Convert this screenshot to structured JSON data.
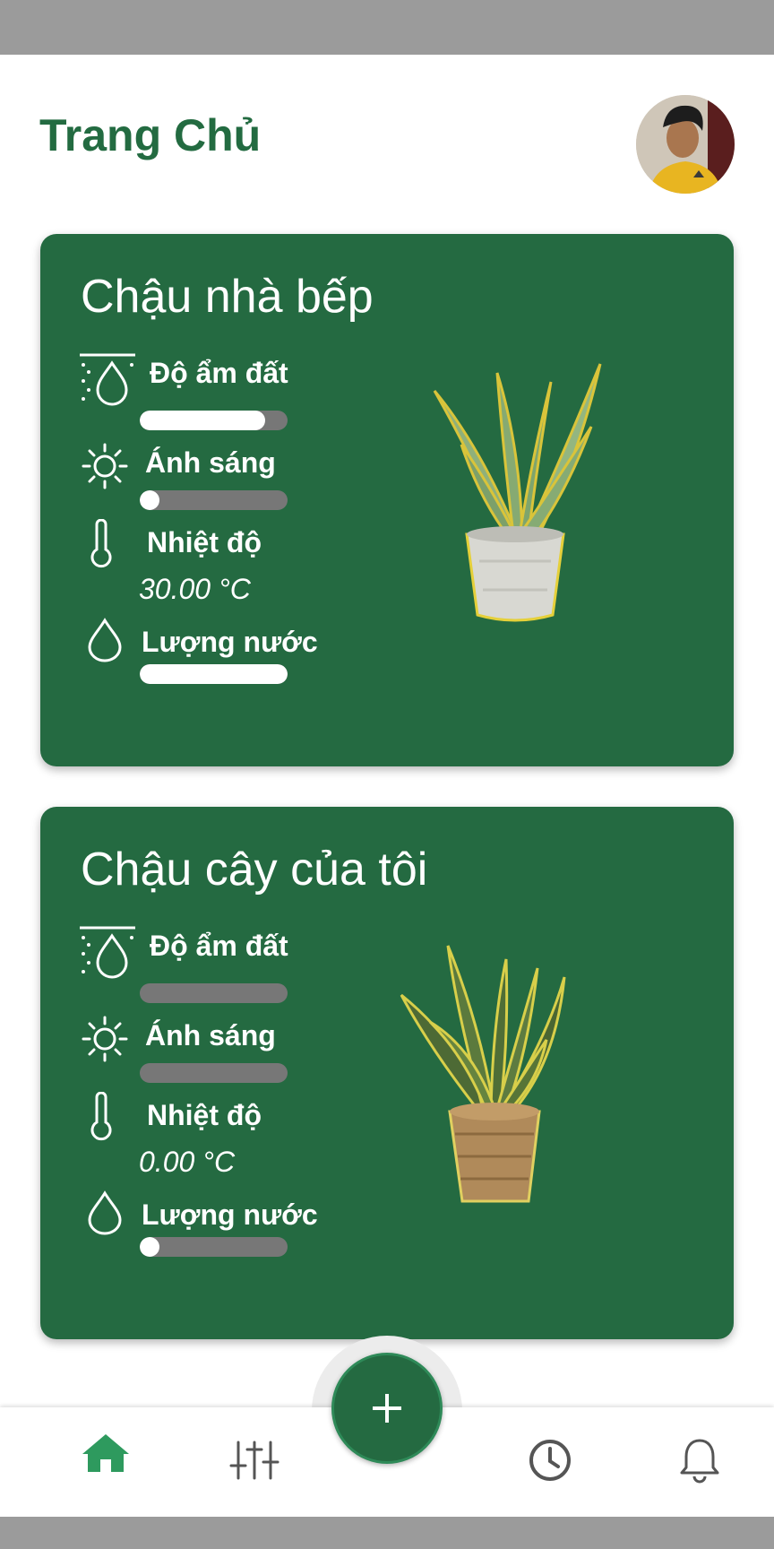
{
  "header": {
    "title": "Trang Chủ",
    "avatar_icon": "user-avatar"
  },
  "pots": [
    {
      "name": "Chậu nhà bếp",
      "plant_icon": "aloe-vera-plant",
      "metrics": {
        "soil_moisture": {
          "label": "Độ ẩm đất",
          "icon": "soil-moisture-icon",
          "level": 0.85
        },
        "light": {
          "label": "Ánh sáng",
          "icon": "sun-icon",
          "level": 0.02
        },
        "temperature": {
          "label": "Nhiệt độ",
          "icon": "thermometer-icon",
          "value": "30.00 °C"
        },
        "water_level": {
          "label": "Lượng nước",
          "icon": "water-drop-icon",
          "level": 1.0
        }
      }
    },
    {
      "name": "Chậu cây của tôi",
      "plant_icon": "snake-plant",
      "metrics": {
        "soil_moisture": {
          "label": "Độ ẩm đất",
          "icon": "soil-moisture-icon",
          "level": 0.0
        },
        "light": {
          "label": "Ánh sáng",
          "icon": "sun-icon",
          "level": 0.0
        },
        "temperature": {
          "label": "Nhiệt độ",
          "icon": "thermometer-icon",
          "value": "0.00 °C"
        },
        "water_level": {
          "label": "Lượng nước",
          "icon": "water-drop-icon",
          "level": 0.02
        }
      }
    }
  ],
  "bottom_nav": {
    "items": [
      {
        "icon": "home-icon",
        "active": true
      },
      {
        "icon": "sliders-icon",
        "active": false
      },
      {
        "icon": "clock-icon",
        "active": false
      },
      {
        "icon": "bell-icon",
        "active": false
      }
    ],
    "fab_icon": "plus-icon"
  },
  "colors": {
    "primary": "#246a41",
    "title_green": "#236b41",
    "active_nav": "#2e9a5e",
    "inactive_nav": "#555555",
    "bar_track": "#777777",
    "bar_fill": "#ffffff"
  }
}
